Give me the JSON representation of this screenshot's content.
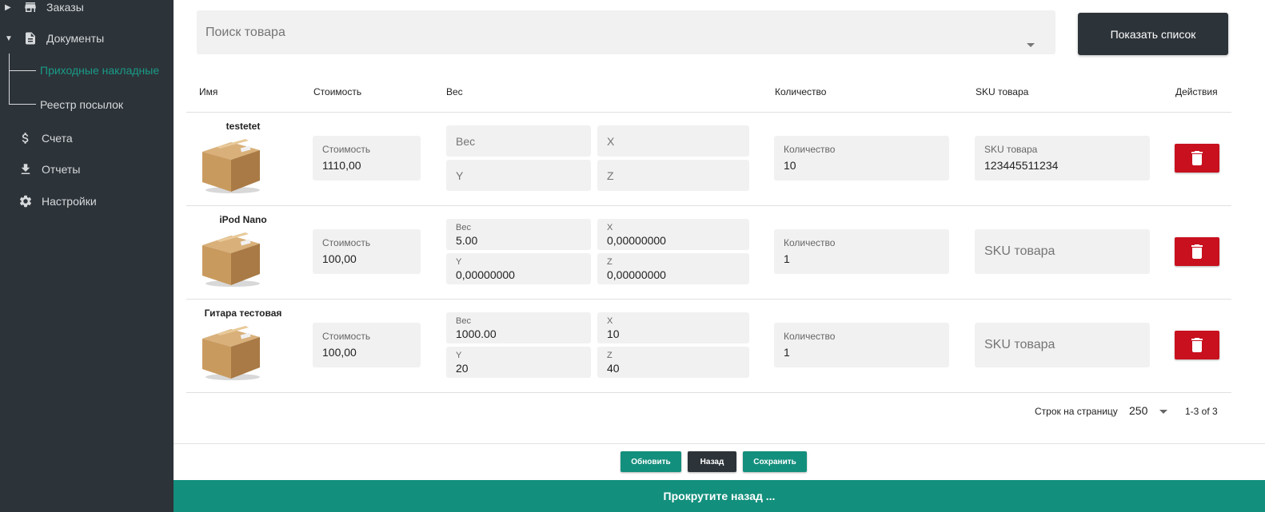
{
  "sidebar": {
    "items": [
      {
        "label": "Заказы",
        "icon": "store-icon"
      },
      {
        "label": "Документы",
        "icon": "document-icon"
      },
      {
        "label": "Счета",
        "icon": "dollar-icon"
      },
      {
        "label": "Отчеты",
        "icon": "download-icon"
      },
      {
        "label": "Настройки",
        "icon": "gear-icon"
      }
    ],
    "subitems": [
      {
        "label": "Приходные накладные",
        "active": true
      },
      {
        "label": "Реестр посылок",
        "active": false
      }
    ]
  },
  "search": {
    "placeholder": "Поиск товара",
    "value": ""
  },
  "show_list_label": "Показать список",
  "table": {
    "headers": [
      "Имя",
      "Стоимость",
      "Вес",
      "Количество",
      "SKU товара",
      "Действия"
    ],
    "rows": [
      {
        "name": "testetet",
        "cost_label": "Стоимость",
        "cost": "1110,00",
        "weight_label": "Вес",
        "weight": "",
        "x_label": "X",
        "x": "",
        "y_label": "Y",
        "y": "",
        "z_label": "Z",
        "z": "",
        "qty_label": "Количество",
        "qty": "10",
        "sku_label": "SKU товара",
        "sku": "123445511234"
      },
      {
        "name": "iPod Nano",
        "cost_label": "Стоимость",
        "cost": "100,00",
        "weight_label": "Вес",
        "weight": "5.00",
        "x_label": "X",
        "x": "0,00000000",
        "y_label": "Y",
        "y": "0,00000000",
        "z_label": "Z",
        "z": "0,00000000",
        "qty_label": "Количество",
        "qty": "1",
        "sku_label": "SKU товара",
        "sku": ""
      },
      {
        "name": "Гитара тестовая",
        "cost_label": "Стоимость",
        "cost": "100,00",
        "weight_label": "Вес",
        "weight": "1000.00",
        "x_label": "X",
        "x": "10",
        "y_label": "Y",
        "y": "20",
        "z_label": "Z",
        "z": "40",
        "qty_label": "Количество",
        "qty": "1",
        "sku_label": "SKU товара",
        "sku": ""
      }
    ]
  },
  "pagination": {
    "rows_per_page_label": "Строк на страницу",
    "rows_per_page": "250",
    "range": "1-3 of 3"
  },
  "buttons": {
    "refresh": "Обновить",
    "back": "Назад",
    "save": "Сохранить"
  },
  "footer": {
    "scroll_back": "Прокрутите назад ..."
  },
  "colors": {
    "sidebar_bg": "#2c3339",
    "accent": "#138f7d",
    "danger": "#c8101e",
    "field_bg": "#f1f1f1"
  }
}
